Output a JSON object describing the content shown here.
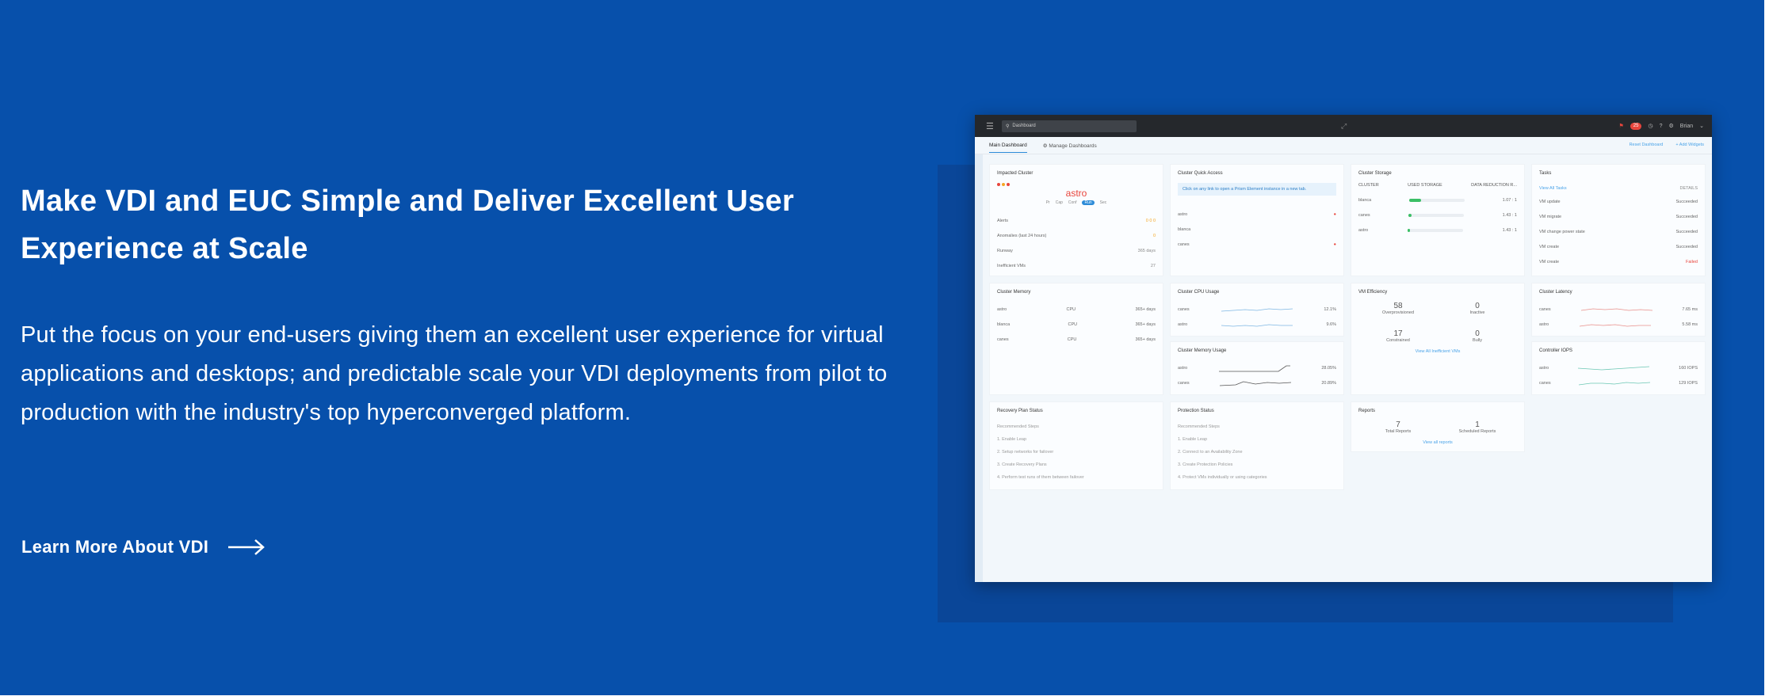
{
  "hero": {
    "title": "Make VDI and EUC Simple and Deliver Excellent User Experience at Scale",
    "body": "Put the focus on your end-users giving them an excellent user experience for virtual applications and desktops; and predictable scale your VDI deployments from pilot to production with the industry's top hyperconverged platform.",
    "cta_label": "Learn More About VDI",
    "cta_icon": "arrow-right-icon"
  },
  "colors": {
    "background": "#0750ab",
    "accent": "#2c8bd8",
    "alert": "#e8453c"
  },
  "dashboard": {
    "search_text": "Dashboard",
    "alert_count": "25",
    "user_label": "Brian",
    "tabs": [
      "Main Dashboard",
      "Manage Dashboards"
    ],
    "tab_actions": [
      "Reset Dashboard",
      "+ Add Widgets"
    ],
    "impacted_cluster": {
      "title": "Impacted Cluster",
      "name": "astro",
      "pills": [
        "Pr",
        "Cap",
        "Conf",
        "Run",
        "Sec"
      ],
      "active_pill": "Run",
      "rows": [
        {
          "label": "Alerts",
          "value": "0  0  0"
        },
        {
          "label": "Anomalies (last 24 hours)",
          "value": "0"
        },
        {
          "label": "Runway",
          "value": "365 days"
        },
        {
          "label": "Inefficient VMs",
          "value": "27"
        }
      ]
    },
    "quick_access": {
      "title": "Cluster Quick Access",
      "notice": "Click on any link to open a Prism Element instance in a new tab.",
      "rows": [
        "astro",
        "blanca",
        "canes"
      ]
    },
    "storage": {
      "title": "Cluster Storage",
      "headers": [
        "CLUSTER",
        "USED STORAGE",
        "DATA REDUCTION R..."
      ],
      "rows": [
        {
          "name": "blanca",
          "fill": 0.22,
          "value": "1.07 : 1"
        },
        {
          "name": "canes",
          "fill": 0.06,
          "value": "1.43 : 1"
        },
        {
          "name": "astro",
          "fill": 0.04,
          "value": "1.43 : 1"
        }
      ]
    },
    "tasks": {
      "title": "Tasks",
      "view_all": "View All Tasks",
      "filter": "DETAILS",
      "rows": [
        {
          "name": "VM update",
          "status": "Succeeded"
        },
        {
          "name": "VM migrate",
          "status": "Succeeded"
        },
        {
          "name": "VM change power state",
          "status": "Succeeded"
        },
        {
          "name": "VM create",
          "status": "Succeeded"
        },
        {
          "name": "VM create",
          "status": "Failed"
        }
      ]
    },
    "memory": {
      "title": "Cluster Memory",
      "rows": [
        {
          "name": "astro",
          "type": "CPU",
          "value": "365+ days"
        },
        {
          "name": "blanca",
          "type": "CPU",
          "value": "365+ days"
        },
        {
          "name": "canes",
          "type": "CPU",
          "value": "365+ days"
        }
      ]
    },
    "cpu_usage": {
      "title": "Cluster CPU Usage",
      "rows": [
        {
          "name": "canes",
          "value": "12.1%"
        },
        {
          "name": "astro",
          "value": "9.6%"
        }
      ]
    },
    "memory_usage": {
      "title": "Cluster Memory Usage",
      "rows": [
        {
          "name": "astro",
          "value": "28.05%"
        },
        {
          "name": "canes",
          "value": "20.89%"
        }
      ]
    },
    "vm_efficiency": {
      "title": "VM Efficiency",
      "stats": [
        {
          "value": "58",
          "label": "Overprovisioned"
        },
        {
          "value": "0",
          "label": "Inactive"
        },
        {
          "value": "17",
          "label": "Constrained"
        },
        {
          "value": "0",
          "label": "Bully"
        }
      ],
      "link": "View All Inefficient VMs"
    },
    "latency": {
      "title": "Cluster Latency",
      "rows": [
        {
          "name": "canes",
          "value": "7.65 ms"
        },
        {
          "name": "astro",
          "value": "5.58 ms"
        }
      ]
    },
    "iops": {
      "title": "Controller IOPS",
      "rows": [
        {
          "name": "astro",
          "value": "160 IOPS"
        },
        {
          "name": "canes",
          "value": "129 IOPS"
        }
      ]
    },
    "recovery": {
      "title": "Recovery Plan Status",
      "subtitle": "Recommended Steps",
      "steps": [
        "1. Enable Leap",
        "2. Setup networks for failover",
        "3. Create Recovery Plans",
        "4. Perform test runs of them between failover"
      ]
    },
    "protection": {
      "title": "Protection Status",
      "subtitle": "Recommended Steps",
      "steps": [
        "1. Enable Leap",
        "2. Connect to an Availability Zone",
        "3. Create Protection Policies",
        "4. Protect VMs individually or using categories"
      ]
    },
    "reports": {
      "title": "Reports",
      "stats": [
        {
          "value": "7",
          "label": "Total Reports"
        },
        {
          "value": "1",
          "label": "Scheduled Reports"
        }
      ],
      "link": "View all reports"
    }
  }
}
